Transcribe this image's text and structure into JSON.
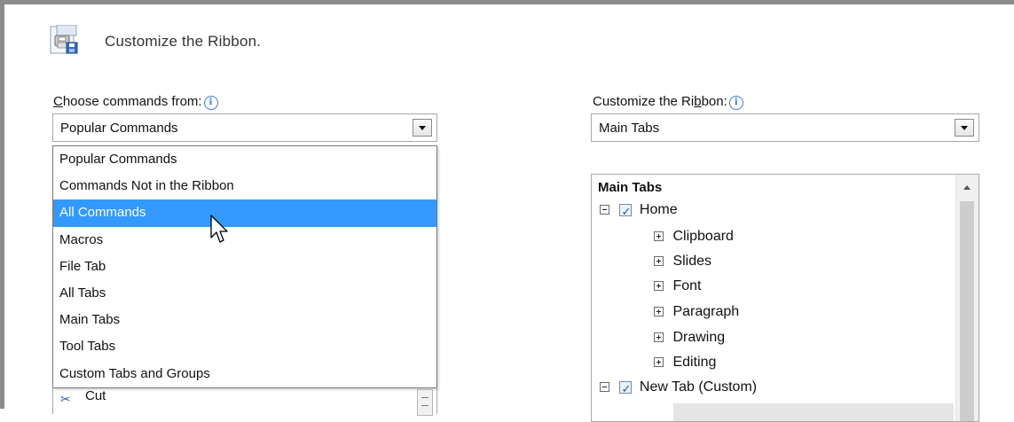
{
  "header": {
    "title": "Customize the Ribbon.",
    "icon": "customize-ribbon-icon"
  },
  "left": {
    "label_underlined": "C",
    "label_rest": "hoose commands from:",
    "combo_value": "Popular Commands",
    "dropdown_options": [
      "Popular Commands",
      "Commands Not in the Ribbon",
      "All Commands",
      "Macros",
      "File Tab",
      "All Tabs",
      "Main Tabs",
      "Tool Tabs",
      "Custom Tabs and Groups"
    ],
    "selected_option": "All Commands",
    "below_item": "Cut"
  },
  "right": {
    "label_pre": "Customize the Ri",
    "label_underlined": "b",
    "label_post": "bon:",
    "combo_value": "Main Tabs",
    "tree_header": "Main Tabs",
    "tree": {
      "home": "Home",
      "groups": [
        "Clipboard",
        "Slides",
        "Font",
        "Paragraph",
        "Drawing",
        "Editing"
      ],
      "new_tab": "New Tab (Custom)"
    }
  },
  "colors": {
    "selection": "#3399ff",
    "info_icon": "#3c7fd0"
  }
}
